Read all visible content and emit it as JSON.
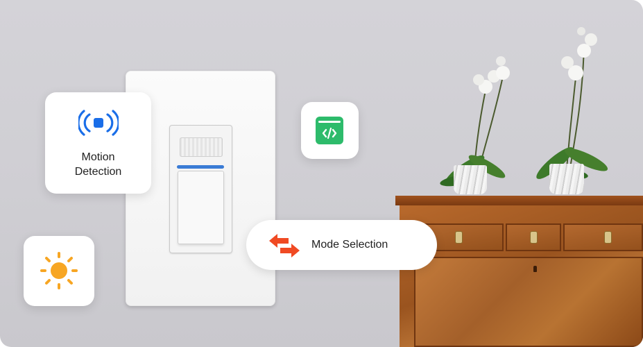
{
  "cards": {
    "motion": {
      "label_line1": "Motion",
      "label_line2": "Detection",
      "icon": "motion-sensor-icon",
      "icon_color": "#1a6ee8"
    },
    "code": {
      "icon": "code-window-icon",
      "icon_color": "#2dbb6b"
    },
    "sun": {
      "icon": "sun-icon",
      "icon_color": "#f7a623"
    },
    "mode": {
      "label": "Mode Selection",
      "icon": "swap-arrows-icon",
      "icon_color": "#f04a23"
    }
  },
  "scene": {
    "objects": [
      "wall-switch-plate",
      "motion-sensor-switch",
      "wooden-cabinet",
      "orchid-plant",
      "orchid-plant"
    ]
  }
}
